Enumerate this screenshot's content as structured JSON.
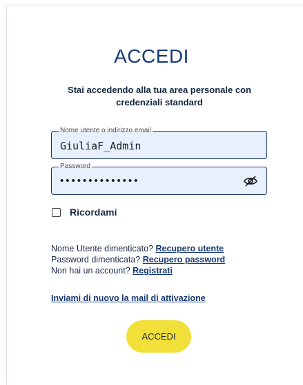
{
  "login": {
    "title": "ACCEDI",
    "subtitle": "Stai accedendo alla tua area personale con credenziali standard",
    "username": {
      "label": "Nome utente o indirizzo email",
      "value": "GiuliaF_Admin"
    },
    "password": {
      "label": "Password",
      "masked_value": "••••••••••••••",
      "toggle_icon": "eye-slash-icon"
    },
    "remember_label": "Ricordami",
    "help": {
      "forgot_user_text": "Nome Utente dimenticato?",
      "forgot_user_link": "Recupero utente",
      "forgot_password_text": "Password dimenticata?",
      "forgot_password_link": "Recupero password",
      "no_account_text": "Non hai un account?",
      "register_link": "Registrati"
    },
    "resend_activation_link": "Inviami di nuovo la mail di attivazione",
    "submit_label": "ACCEDI",
    "colors": {
      "primary": "#163a74",
      "button": "#f2e03a",
      "field_bg": "#e8f0fe"
    }
  }
}
